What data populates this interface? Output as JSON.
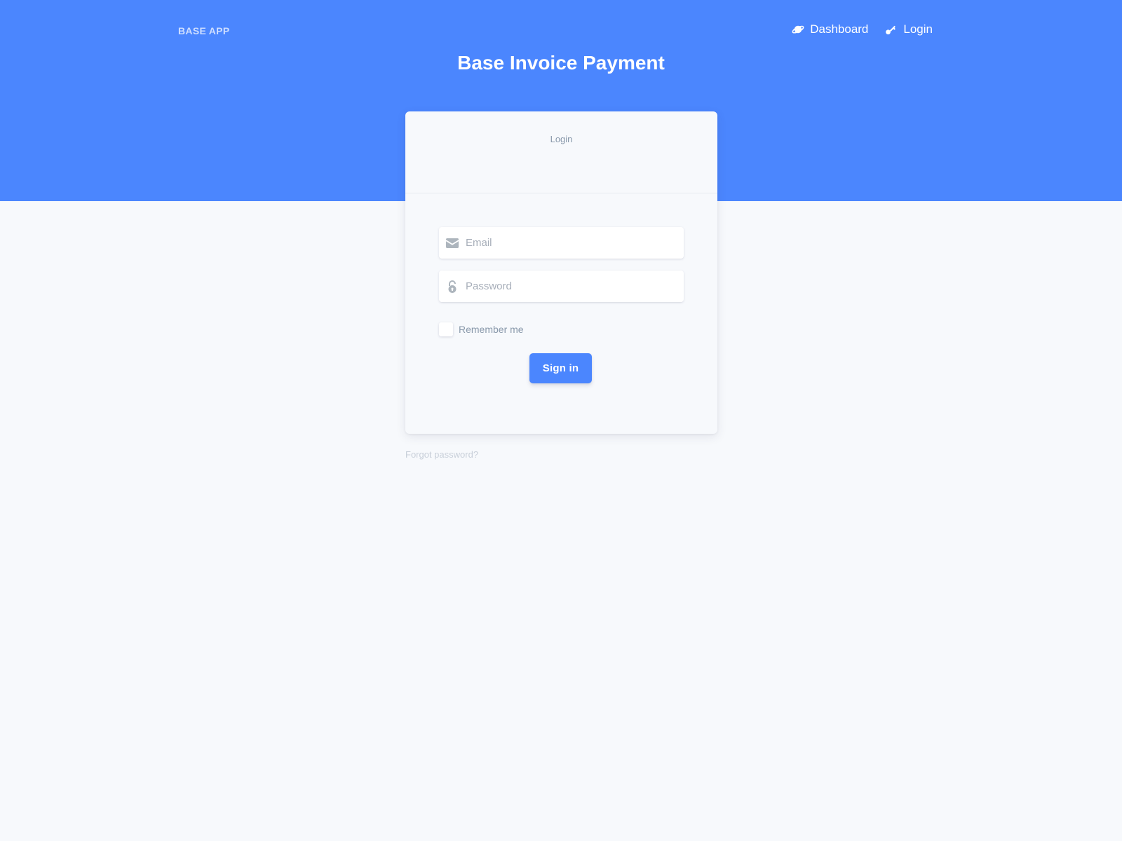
{
  "header": {
    "brand": "BASE APP",
    "nav": [
      {
        "label": "Dashboard",
        "icon": "planet-icon"
      },
      {
        "label": "Login",
        "icon": "key-icon"
      }
    ],
    "title": "Base Invoice Payment",
    "background_color": "#4b86fe"
  },
  "login_card": {
    "header": "Login",
    "email": {
      "placeholder": "Email",
      "value": "",
      "icon": "envelope-icon"
    },
    "password": {
      "placeholder": "Password",
      "value": "",
      "icon": "lock-open-icon"
    },
    "remember_label": "Remember me",
    "remember_checked": false,
    "submit_label": "Sign in"
  },
  "footer": {
    "forgot_password": "Forgot password?"
  }
}
